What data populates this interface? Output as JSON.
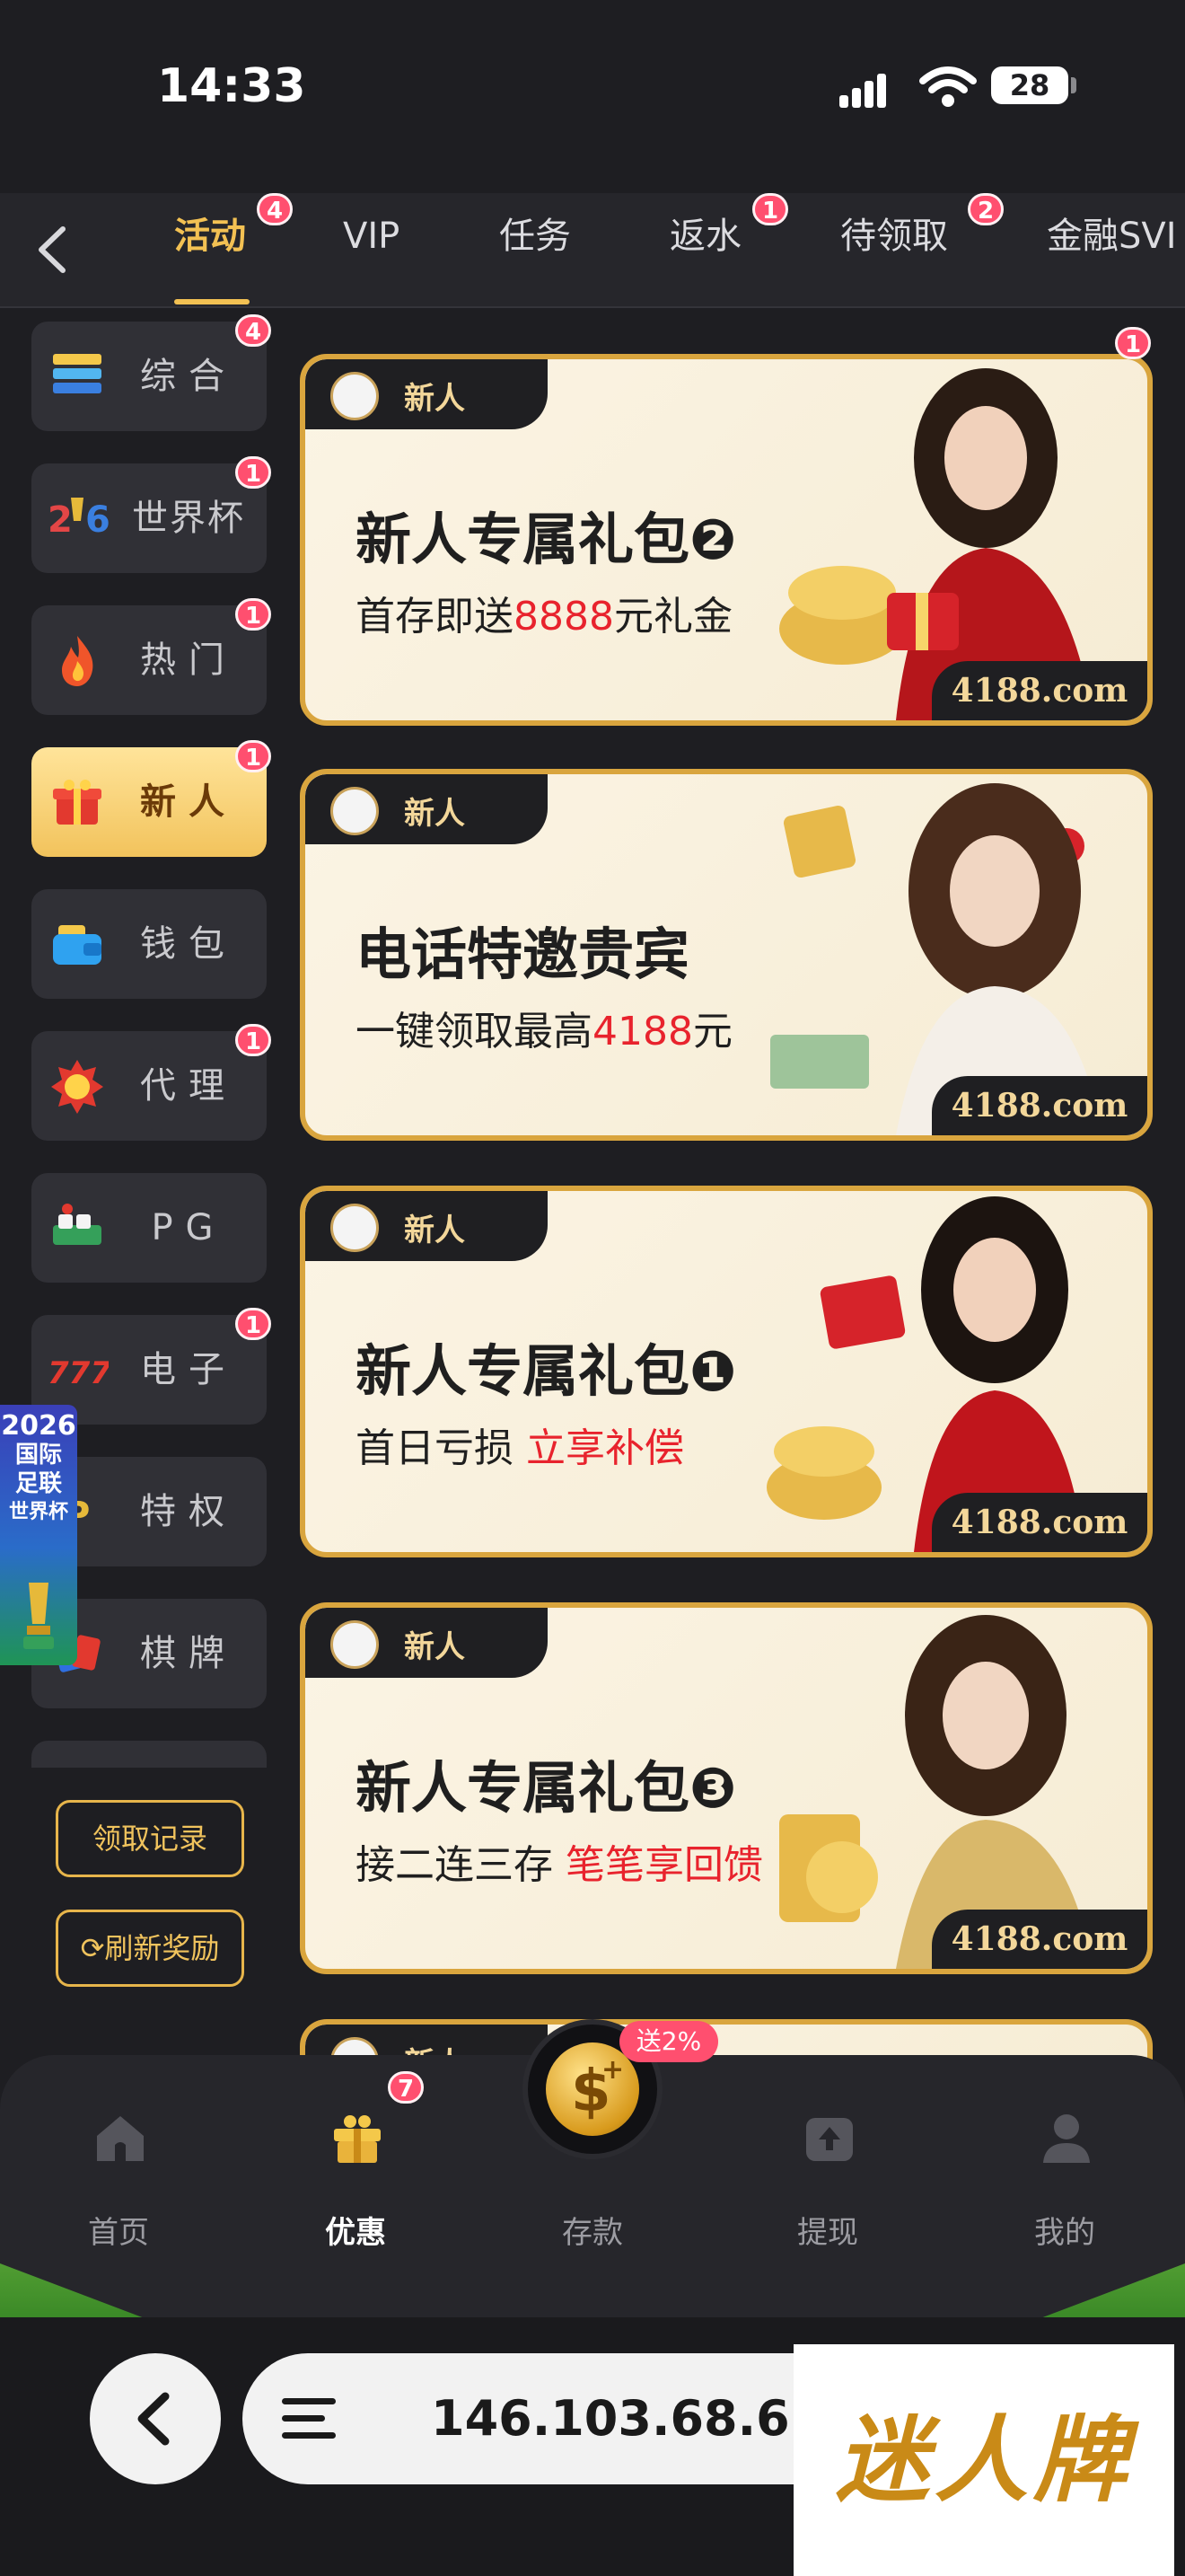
{
  "status": {
    "time": "14:33",
    "battery": "28"
  },
  "tabs": [
    {
      "label": "活动",
      "badge": "4",
      "active": true
    },
    {
      "label": "VIP",
      "badge": ""
    },
    {
      "label": "任务",
      "badge": ""
    },
    {
      "label": "返水",
      "badge": "1"
    },
    {
      "label": "待领取",
      "badge": "2"
    },
    {
      "label": "金融SVI",
      "badge": ""
    }
  ],
  "sidebar": {
    "items": [
      {
        "label": "综合",
        "badge": "4",
        "icon": "layers-icon"
      },
      {
        "label": "世界杯",
        "badge": "1",
        "icon": "world-cup-icon"
      },
      {
        "label": "热门",
        "badge": "1",
        "icon": "fire-icon"
      },
      {
        "label": "新人",
        "badge": "1",
        "icon": "gift-icon",
        "active": true
      },
      {
        "label": "钱包",
        "badge": "",
        "icon": "wallet-icon"
      },
      {
        "label": "代理",
        "badge": "1",
        "icon": "medal-icon"
      },
      {
        "label": "PG",
        "badge": "",
        "icon": "pg-icon"
      },
      {
        "label": "电子",
        "badge": "1",
        "icon": "slot-777-icon"
      },
      {
        "label": "特权",
        "badge": "",
        "icon": "vip-icon"
      },
      {
        "label": "棋牌",
        "badge": "",
        "icon": "cards-icon"
      }
    ],
    "claim_record": "领取记录",
    "refresh_rewards": "刷新奖励"
  },
  "cards": [
    {
      "tag": "新人",
      "title": "新人专属礼包❷",
      "sub_pre": "首存即送",
      "sub_hl": "8888",
      "sub_post": "元礼金",
      "domain": "4188.com",
      "badge": "1"
    },
    {
      "tag": "新人",
      "title": "电话特邀贵宾",
      "sub_pre": "一键领取最高",
      "sub_hl": "4188",
      "sub_post": "元",
      "domain": "4188.com",
      "badge": ""
    },
    {
      "tag": "新人",
      "title": "新人专属礼包❶",
      "sub_pre": "首日亏损 ",
      "sub_hl": "立享补偿",
      "sub_post": "",
      "domain": "4188.com",
      "badge": ""
    },
    {
      "tag": "新人",
      "title": "新人专属礼包❸",
      "sub_pre": "接二连三存 ",
      "sub_hl": "笔笔享回馈",
      "sub_post": "",
      "domain": "4188.com",
      "badge": ""
    }
  ],
  "partial_card_tag": "新人",
  "world_cup_banner": [
    "2026",
    "国际",
    "足联",
    "世界杯"
  ],
  "bottom_nav": {
    "items": [
      {
        "label": "首页",
        "icon": "home-icon"
      },
      {
        "label": "优惠",
        "icon": "gift-box-icon",
        "badge": "7",
        "active": true
      },
      {
        "label": "存款",
        "icon": "dollar-coin-icon",
        "pill": "送2%"
      },
      {
        "label": "提现",
        "icon": "upload-icon"
      },
      {
        "label": "我的",
        "icon": "user-icon"
      }
    ]
  },
  "browser": {
    "url": "146.103.68.6"
  },
  "logo_text": "迷人牌",
  "colors": {
    "accent": "#f3c153",
    "badge": "#ff4f6f",
    "highlight": "#e8232d",
    "background": "#1e1e22"
  }
}
